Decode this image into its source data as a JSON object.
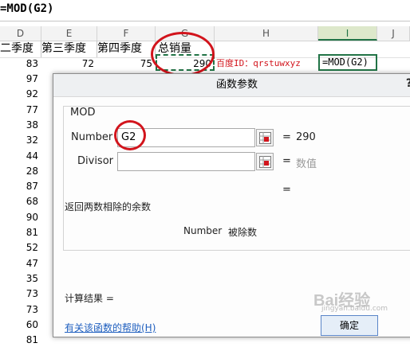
{
  "formula_bar": {
    "text": "=MOD(G2)"
  },
  "columns": [
    "D",
    "E",
    "F",
    "G",
    "H",
    "I",
    "J"
  ],
  "header_row": {
    "d": "二季度",
    "e": "第三季度",
    "f": "第四季度",
    "g": "总销量"
  },
  "first_row": {
    "d": "83",
    "e": "72",
    "f": "75",
    "g": "290",
    "h": "百度ID：qrstuwxyz",
    "i": "=MOD(G2)"
  },
  "d_values": [
    "97",
    "92",
    "77",
    "38",
    "32",
    "44",
    "28",
    "87",
    "68",
    "90",
    "81",
    "52",
    "47",
    "35",
    "73",
    "73",
    "60",
    "81"
  ],
  "dialog": {
    "title": "函数参数",
    "help": "?",
    "function_name": "MOD",
    "arg1_label": "Number",
    "arg1_value": "G2",
    "arg1_equals": "=",
    "arg1_result": "290",
    "arg2_label": "Divisor",
    "arg2_value": "",
    "arg2_equals": "=",
    "arg2_result": "数值",
    "overall_equals": "=",
    "description": "返回两数相除的余数",
    "param_desc_name": "Number",
    "param_desc_text": "被除数",
    "calc_result_label": "计算结果 =",
    "help_link": "有关该函数的帮助(H)",
    "ok_label": "确定"
  },
  "watermark": {
    "text": "Bai经验",
    "sub": "jingyan.baidu.com"
  }
}
